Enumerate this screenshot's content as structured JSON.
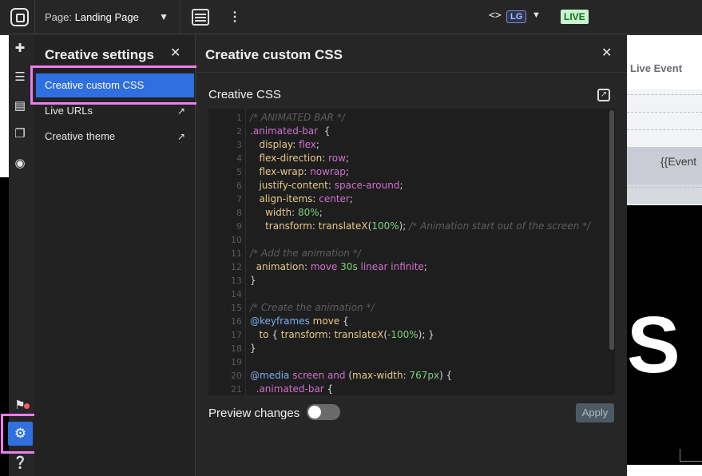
{
  "topbar": {
    "page_prefix": "Page:",
    "page_name": "Landing Page",
    "breakpoint": "LG",
    "status": "LIVE"
  },
  "settings": {
    "title": "Creative settings",
    "items": [
      {
        "label": "Creative custom CSS",
        "active": true
      },
      {
        "label": "Live URLs",
        "external": true
      },
      {
        "label": "Creative theme",
        "external": true
      }
    ]
  },
  "css_panel": {
    "title": "Creative custom CSS",
    "editor_label": "Creative CSS",
    "preview_label": "Preview changes",
    "apply_label": "Apply",
    "preview_enabled": false,
    "line_numbers": [
      "1",
      "2",
      "3",
      "4",
      "5",
      "6",
      "7",
      "8",
      "9",
      "10",
      "11",
      "12",
      "13",
      "14",
      "15",
      "16",
      "17",
      "18",
      "19",
      "20",
      "21"
    ],
    "code": {
      "l1": "/* ANIMATED BAR */",
      "l2_sel": ".animated-bar",
      "l2_brace": "  {",
      "l3_prop": "display",
      "l3_val": "flex",
      "l4_prop": "flex-direction",
      "l4_val": "row",
      "l5_prop": "flex-wrap",
      "l5_val": "nowrap",
      "l6_prop": "justify-content",
      "l6_val": "space-around",
      "l7_prop": "align-items",
      "l7_val": "center",
      "l8_prop": "width",
      "l8_val": "80%",
      "l9_prop": "transform",
      "l9_fn": "translateX",
      "l9_arg": "100%",
      "l9_com": "/* Animation start out of the screen */",
      "l11": "/* Add the animation */",
      "l12_prop": "animation",
      "l12_v1": "move",
      "l12_v2": "30s",
      "l12_v3": "linear infinite",
      "l13": "}",
      "l15": "/* Create the animation */",
      "l16_at": "@keyframes",
      "l16_name": "move",
      "l17_to": "to",
      "l17_prop": "transform",
      "l17_fn": "translateX",
      "l17_arg": "-100%",
      "l18": "}",
      "l20_at": "@media",
      "l20_v1": "screen",
      "l20_v2": "and",
      "l20_prop": "max-width",
      "l20_num": "767px",
      "l21_sel": ".animated-bar"
    }
  },
  "preview": {
    "event_title": "Live Event",
    "template_text": "{{Event",
    "big_letter": "S"
  },
  "colors": {
    "accent": "#2f6fe0",
    "highlight_frame": "#ef7cf0",
    "live_bg": "#c8f5cf"
  }
}
